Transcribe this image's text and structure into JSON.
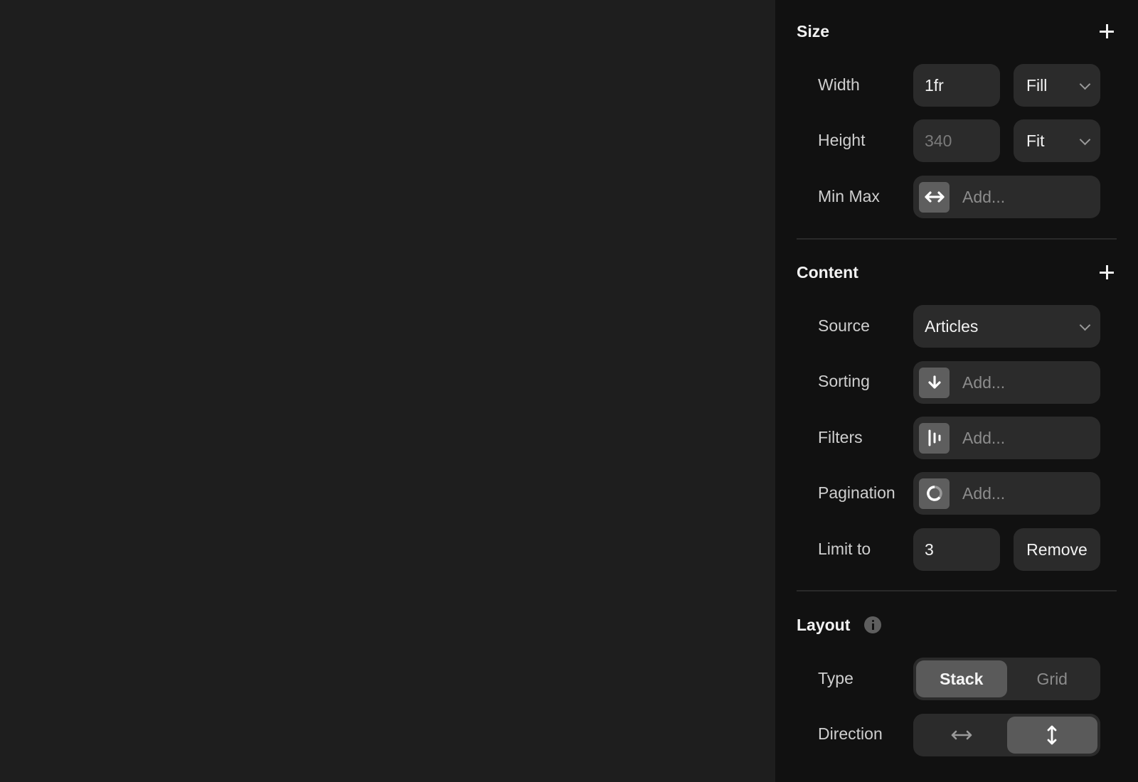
{
  "size": {
    "title": "Size",
    "add_icon": "plus-icon",
    "width": {
      "label": "Width",
      "value": "1fr",
      "mode": "Fill"
    },
    "height": {
      "label": "Height",
      "placeholder": "340",
      "mode": "Fit"
    },
    "minmax": {
      "label": "Min Max",
      "icon": "horizontal-arrows-icon",
      "placeholder": "Add..."
    }
  },
  "content": {
    "title": "Content",
    "add_icon": "plus-icon",
    "source": {
      "label": "Source",
      "value": "Articles"
    },
    "sorting": {
      "label": "Sorting",
      "icon": "arrow-down-icon",
      "placeholder": "Add..."
    },
    "filters": {
      "label": "Filters",
      "icon": "filter-bars-icon",
      "placeholder": "Add..."
    },
    "pagination": {
      "label": "Pagination",
      "icon": "loading-ring-icon",
      "placeholder": "Add..."
    },
    "limit": {
      "label": "Limit to",
      "value": "3",
      "remove_label": "Remove"
    }
  },
  "layout": {
    "title": "Layout",
    "info_icon": "info-icon",
    "type": {
      "label": "Type",
      "options": [
        "Stack",
        "Grid"
      ],
      "selected": "Stack"
    },
    "direction": {
      "label": "Direction",
      "options": [
        "horizontal",
        "vertical"
      ],
      "selected": "vertical"
    }
  },
  "colors": {
    "canvas": "#1e1e1e",
    "panel": "#111111",
    "field": "#2b2b2b",
    "active_segment": "#5a5a5a"
  }
}
